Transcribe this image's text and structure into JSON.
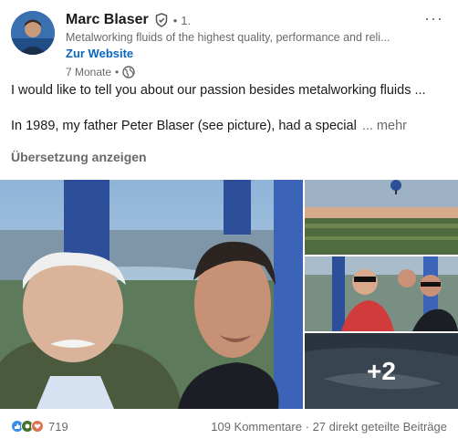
{
  "post": {
    "author": {
      "name": "Marc Blaser",
      "bullet": "•",
      "degree": "1.",
      "headline": "Metalworking fluids of the highest quality, performance and reli...",
      "website_label": "Zur Website",
      "time": "7 Monate",
      "time_sep": "•"
    },
    "menu_label": "···",
    "text_line1": "I would like to tell you about our passion besides metalworking fluids ...",
    "text_line2": "In 1989, my father Peter Blaser (see picture), had a special",
    "more_label": "... mehr",
    "translate_label": "Übersetzung anzeigen",
    "media": {
      "extra_count": "+2"
    },
    "footer": {
      "reaction_count": "719",
      "comments": "109 Kommentare",
      "separator": "·",
      "shares": "27 direkt geteilte Beiträge"
    }
  },
  "colors": {
    "link": "#0a66c2",
    "like": "#378fe9",
    "celebrate": "#44712e",
    "love": "#df704d"
  },
  "icons": [
    "verified-icon",
    "globe-icon",
    "more-options-icon",
    "like-reaction-icon",
    "celebrate-reaction-icon",
    "love-reaction-icon"
  ]
}
